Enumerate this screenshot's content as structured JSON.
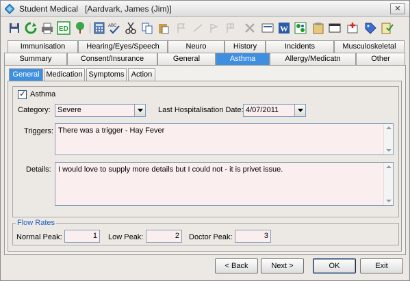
{
  "window": {
    "app_title": "Student Medical",
    "record": "[Aardvark, James (Jim)]",
    "close_label": "✕"
  },
  "toolbar": {
    "icons": [
      "save-icon",
      "refresh-icon",
      "print-icon",
      "edit-ed-icon",
      "tree-icon",
      "calculator-icon",
      "spellcheck-icon",
      "cut-icon",
      "copy-icon",
      "paste-icon",
      "flag-icon",
      "line-icon",
      "flag2-icon",
      "flag3-icon",
      "delete-icon",
      "message-icon",
      "word-icon",
      "excel-icon",
      "report-icon",
      "card-icon",
      "first-aid-icon",
      "tag-icon",
      "checklist-icon"
    ],
    "ed_label": "ED"
  },
  "tabs_row1": [
    "Immunisation",
    "Hearing/Eyes/Speech",
    "Neuro",
    "History",
    "Incidents",
    "Musculoskeletal"
  ],
  "tabs_row2": [
    "Summary",
    "Consent/Insurance",
    "General",
    "Asthma",
    "Allergy/Medicatn",
    "Other"
  ],
  "subtabs": [
    "General",
    "Medication",
    "Symptoms",
    "Action"
  ],
  "form": {
    "asthma_check_label": "Asthma",
    "category_label": "Category:",
    "category_value": "Severe",
    "last_hosp_label": "Last Hospitalisation Date:",
    "last_hosp_value": "4/07/2011",
    "triggers_label": "Triggers:",
    "triggers_value": "There was a trigger - Hay Fever",
    "details_label": "Details:",
    "details_value": "I would love to supply more details but I could not  - it is privet issue."
  },
  "flow_rates": {
    "legend": "Flow Rates",
    "normal_label": "Normal Peak:",
    "normal_value": "1",
    "low_label": "Low Peak:",
    "low_value": "2",
    "doctor_label": "Doctor Peak:",
    "doctor_value": "3"
  },
  "buttons": {
    "back": "Back",
    "back_prefix": "< ",
    "next": "Next >",
    "ok": "OK",
    "exit": "Exit"
  },
  "colors": {
    "active_tab": "#3f8fe0",
    "field_bg": "#fbeeee"
  }
}
